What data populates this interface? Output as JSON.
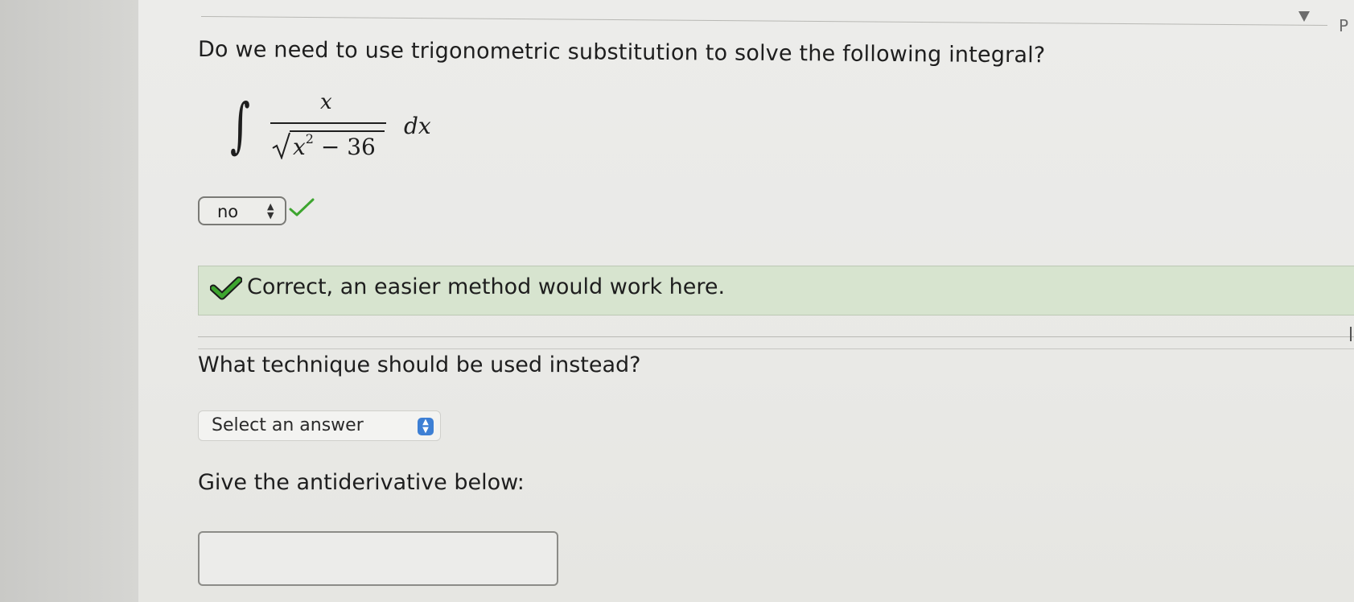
{
  "question1": {
    "text": "Do we need to use trigonometric substitution to solve the following integral?"
  },
  "integral": {
    "numerator": "x",
    "denominator_base": "x",
    "denominator_exponent": "2",
    "denominator_rest": " − 36",
    "differential": "dx"
  },
  "answer_select_1": {
    "value": "no",
    "status": "correct"
  },
  "feedback": {
    "message": "Correct, an easier method would work here."
  },
  "question2": {
    "text": "What technique should be used instead?"
  },
  "answer_select_2": {
    "value": "Select an answer"
  },
  "question3": {
    "text": "Give the antiderivative below:"
  },
  "antiderivative_input": {
    "value": ""
  },
  "corner": {
    "letter": "P"
  },
  "colors": {
    "correct_green": "#3da52f",
    "feedback_bg": "#d7e4cf",
    "select_stepper": "#3d7fd4"
  }
}
